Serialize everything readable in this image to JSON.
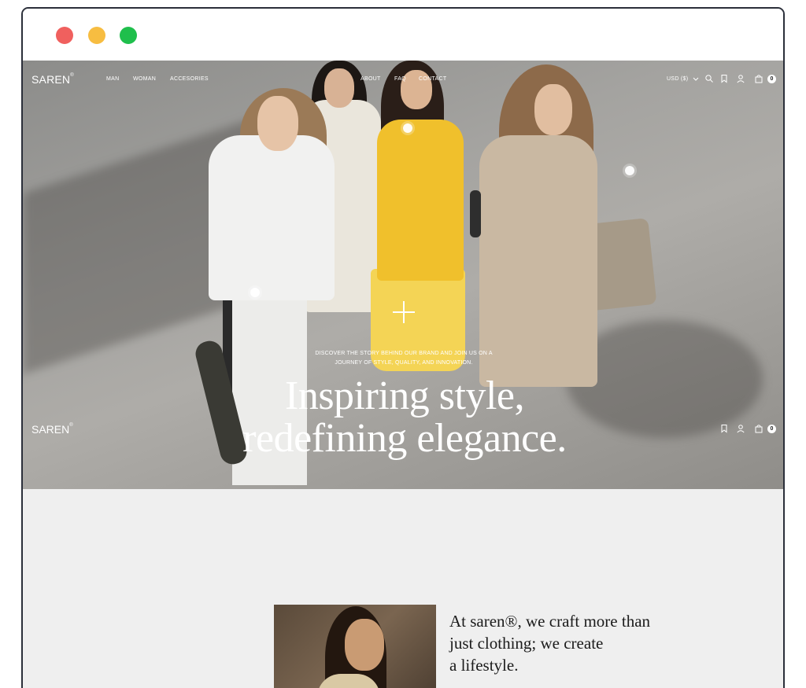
{
  "window": {
    "controls": [
      "close",
      "minimize",
      "maximize"
    ]
  },
  "nav": {
    "logo": "SAREN",
    "logo_mark": "®",
    "left_links": [
      "MAN",
      "WOMAN",
      "ACCESORIES"
    ],
    "right_links": [
      "ABOUT",
      "FAQ",
      "CONTACT"
    ],
    "currency": "USD ($)",
    "cart_count": "0"
  },
  "hero": {
    "subtitle": "DISCOVER THE STORY BEHIND OUR BRAND AND JOIN US ON A JOURNEY OF STYLE, QUALITY, AND INNOVATION.",
    "headline_line1": "Inspiring style,",
    "headline_line2": "redefining elegance."
  },
  "sticky": {
    "logo": "SAREN",
    "logo_mark": "®",
    "cart_count": "0"
  },
  "about": {
    "line1": "At saren®, we craft more than",
    "line2": "just clothing; we create",
    "line3": "a lifestyle."
  },
  "colors": {
    "dot_red": "#f0605e",
    "dot_yellow": "#f7bd41",
    "dot_green": "#1fbf4c",
    "section_bg": "#efefef"
  },
  "icons": [
    "chevron-down-icon",
    "search-icon",
    "bookmark-icon",
    "user-icon",
    "bag-icon",
    "plus-icon"
  ]
}
